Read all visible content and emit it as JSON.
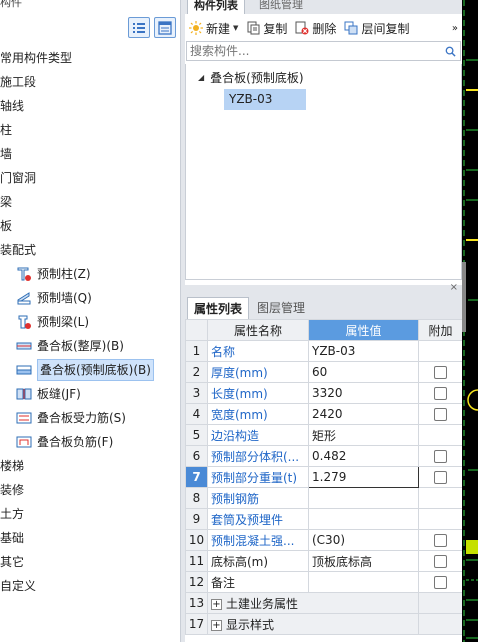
{
  "left_panel": {
    "header": "构件",
    "tree": [
      {
        "label": "常用构件类型",
        "level": 0
      },
      {
        "label": "施工段",
        "level": 0
      },
      {
        "label": "轴线",
        "level": 0
      },
      {
        "label": "柱",
        "level": 0
      },
      {
        "label": "墙",
        "level": 0
      },
      {
        "label": "门窗洞",
        "level": 0
      },
      {
        "label": "梁",
        "level": 0
      },
      {
        "label": "板",
        "level": 0
      },
      {
        "label": "装配式",
        "level": 0
      },
      {
        "label": "预制柱(Z)",
        "level": 1,
        "icon": "precast-column-icon"
      },
      {
        "label": "预制墙(Q)",
        "level": 1,
        "icon": "precast-wall-icon"
      },
      {
        "label": "预制梁(L)",
        "level": 1,
        "icon": "precast-beam-icon"
      },
      {
        "label": "叠合板(整厚)(B)",
        "level": 1,
        "icon": "composite-slab-full-icon"
      },
      {
        "label": "叠合板(预制底板)(B)",
        "level": 1,
        "icon": "composite-slab-precast-icon",
        "selected": true
      },
      {
        "label": "板缝(JF)",
        "level": 1,
        "icon": "slab-joint-icon"
      },
      {
        "label": "叠合板受力筋(S)",
        "level": 1,
        "icon": "slab-main-rebar-icon"
      },
      {
        "label": "叠合板负筋(F)",
        "level": 1,
        "icon": "slab-negative-rebar-icon"
      },
      {
        "label": "楼梯",
        "level": 0
      },
      {
        "label": "装修",
        "level": 0
      },
      {
        "label": "土方",
        "level": 0
      },
      {
        "label": "基础",
        "level": 0
      },
      {
        "label": "其它",
        "level": 0
      },
      {
        "label": "自定义",
        "level": 0
      }
    ]
  },
  "component_panel": {
    "tabs": [
      "构件列表",
      "图纸管理"
    ],
    "toolbar": {
      "new_label": "新建",
      "copy_label": "复制",
      "delete_label": "删除",
      "floor_copy_label": "层间复制",
      "more": "»"
    },
    "search": {
      "placeholder": "搜索构件..."
    },
    "tree": {
      "parent": "叠合板(预制底板)",
      "child": "YZB-03"
    }
  },
  "properties_panel": {
    "close": "×",
    "tabs": [
      "属性列表",
      "图层管理"
    ],
    "columns": {
      "name": "属性名称",
      "value": "属性值",
      "extra": "附加"
    },
    "rows": [
      {
        "num": "1",
        "name": "名称",
        "value": "YZB-03",
        "blue": true,
        "check": false
      },
      {
        "num": "2",
        "name": "厚度(mm)",
        "value": "60",
        "blue": true,
        "check": true
      },
      {
        "num": "3",
        "name": "长度(mm)",
        "value": "3320",
        "blue": true,
        "check": true
      },
      {
        "num": "4",
        "name": "宽度(mm)",
        "value": "2420",
        "blue": true,
        "check": true
      },
      {
        "num": "5",
        "name": "边沿构造",
        "value": "矩形",
        "blue": true,
        "check": false
      },
      {
        "num": "6",
        "name": "预制部分体积(...",
        "value": "0.482",
        "blue": true,
        "check": true
      },
      {
        "num": "7",
        "name": "预制部分重量(t)",
        "value": "1.279",
        "blue": true,
        "check": true,
        "current": true
      },
      {
        "num": "8",
        "name": "预制钢筋",
        "value": "",
        "blue": true,
        "check": false
      },
      {
        "num": "9",
        "name": "套筒及预埋件",
        "value": "",
        "blue": true,
        "check": false
      },
      {
        "num": "10",
        "name": "预制混凝土强...",
        "value": "(C30)",
        "blue": true,
        "check": true
      },
      {
        "num": "11",
        "name": "底标高(m)",
        "value": "顶板底标高",
        "blue": false,
        "check": true
      },
      {
        "num": "12",
        "name": "备注",
        "value": "",
        "blue": false,
        "check": true
      },
      {
        "num": "13",
        "name": "土建业务属性",
        "value": "",
        "blue": false,
        "group": true
      },
      {
        "num": "17",
        "name": "显示样式",
        "value": "",
        "blue": false,
        "group": true
      }
    ]
  },
  "colors": {
    "header_blue": "#5b9be0",
    "selection_blue": "#b7d3f4",
    "link_blue": "#1f66c7"
  }
}
